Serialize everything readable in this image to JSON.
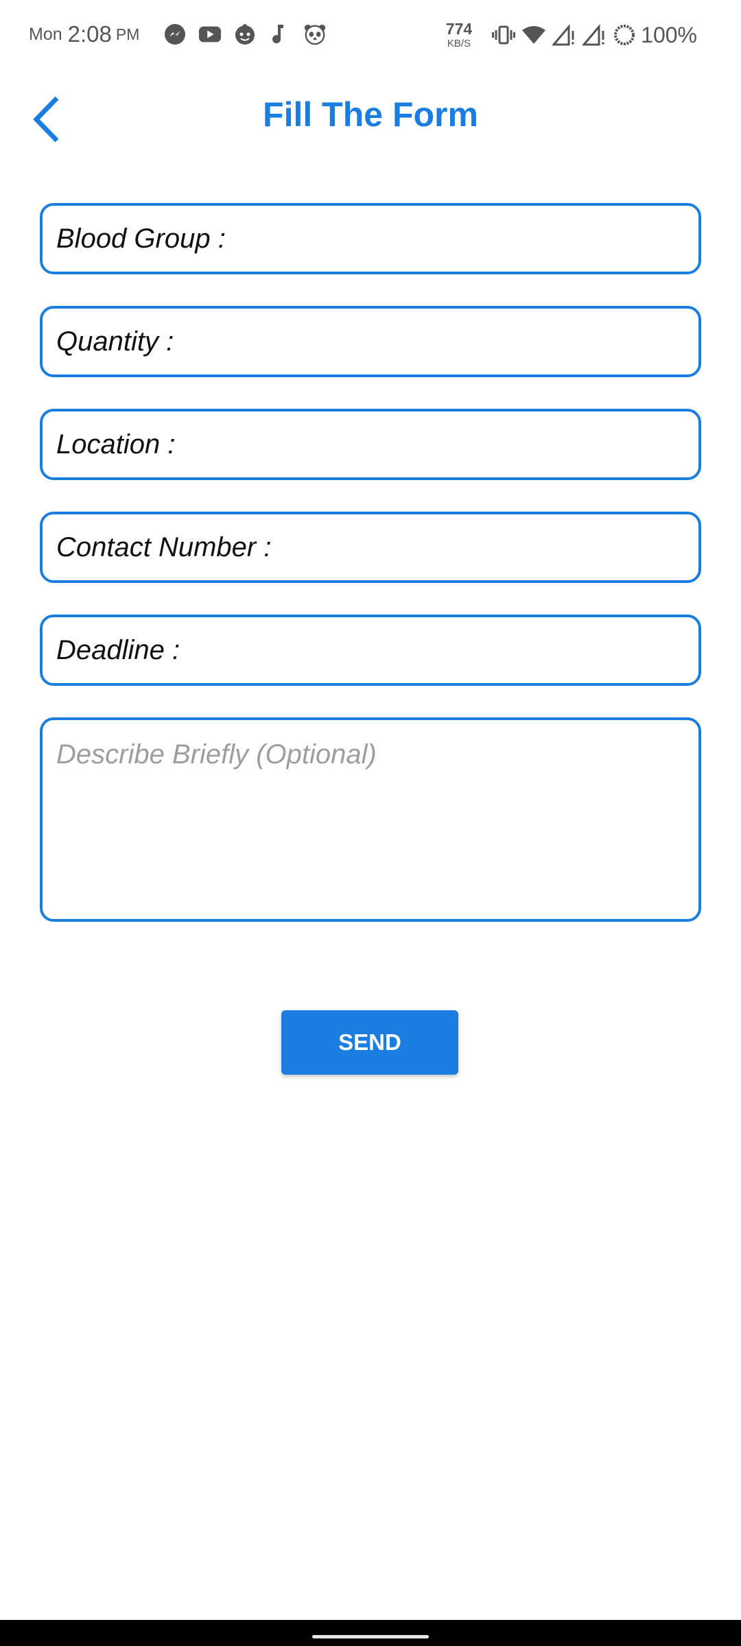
{
  "status_bar": {
    "day": "Mon",
    "time": "2:08",
    "ampm": "PM",
    "app_icons": [
      "messenger-icon",
      "youtube-icon",
      "baby-face-icon",
      "music-note-icon",
      "panda-icon"
    ],
    "net_speed_value": "774",
    "net_speed_unit": "KB/S",
    "system_icons": [
      "vibrate-icon",
      "wifi-icon",
      "signal-icon",
      "signal-icon"
    ],
    "battery_percent": "100%"
  },
  "header": {
    "title": "Fill The Form",
    "back_icon": "chevron-left-icon"
  },
  "form": {
    "blood_group_label": "Blood Group :",
    "quantity_label": "Quantity :",
    "location_label": "Location :",
    "contact_number_label": "Contact Number :",
    "deadline_label": "Deadline :",
    "description_placeholder": "Describe Briefly (Optional)",
    "send_label": "SEND"
  },
  "colors": {
    "accent": "#1a7ee0",
    "placeholder": "#9e9e9e",
    "text": "#111111"
  }
}
